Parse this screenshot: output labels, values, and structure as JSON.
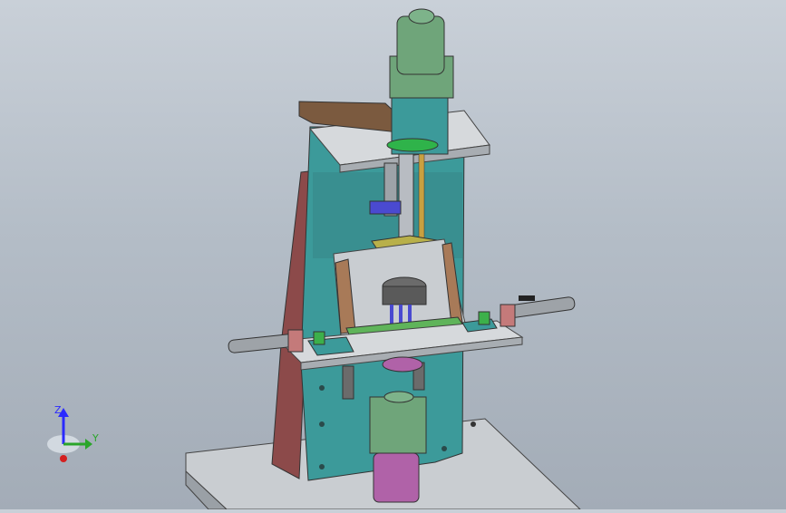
{
  "triad": {
    "z_label": "Z",
    "y_label": "Y"
  },
  "colors": {
    "background_top": "#c9d0d8",
    "background_bottom": "#a3acb7",
    "teal_frame": "#3c9a9a",
    "maroon_side": "#8c4a4a",
    "motor_green": "#6fa57a",
    "cylinder_magenta": "#b062a8",
    "brown_arm": "#7b5a3f",
    "green_plate": "#5fb45a"
  }
}
